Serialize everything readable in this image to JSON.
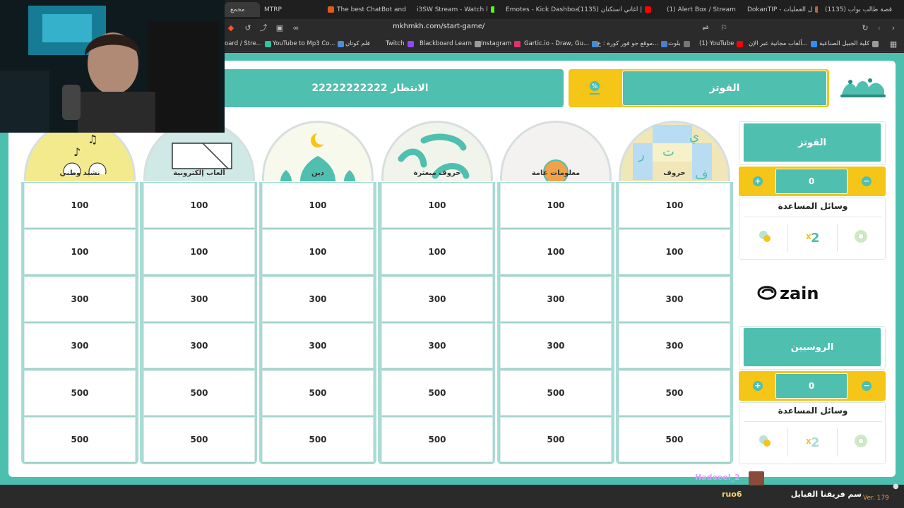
{
  "browser": {
    "tabs": [
      {
        "label": "مجمع",
        "color": "#5a5a5a"
      },
      {
        "label": "MTRP",
        "color": "#777"
      },
      {
        "label": "The best ChatBot and",
        "color": "#e25a1c"
      },
      {
        "label": "i3SW Stream - Watch l",
        "color": "#53fc18"
      },
      {
        "label": "Emotes - Kick Dashboa",
        "color": "#53fc18"
      },
      {
        "label": "(1135) اغاني استكنان |",
        "color": "#ff0000"
      },
      {
        "label": "(1) Alert Box / Stream",
        "color": "#31c3a2"
      },
      {
        "label": "DokanTIP - ل العمليات",
        "color": "#a9694a"
      },
      {
        "label": "(1135) قصة طالب بواب",
        "color": "#ff0000"
      }
    ],
    "url": "mkhmkh.com/start-game/",
    "bookmarks": [
      {
        "label": "oard / Stre...",
        "color": "#31c3a2"
      },
      {
        "label": "YouTube to Mp3 Co...",
        "color": "#4a90d9"
      },
      {
        "label": "فلم كوتان",
        "color": "#9b9b9b"
      },
      {
        "label": "Twitch",
        "color": "#9146ff"
      },
      {
        "label": "Blackboard Learn",
        "color": "#9b9b9b"
      },
      {
        "label": "Instagram",
        "color": "#e1306c"
      },
      {
        "label": "Gartic.io - Draw, Gu...",
        "color": "#3f8ed8"
      },
      {
        "label": "موقع جو فور كورة : ع...",
        "color": "#4a7fd1"
      },
      {
        "label": "بلوت",
        "color": "#777"
      },
      {
        "label": "(1) YouTube",
        "color": "#ff0000"
      },
      {
        "label": "ألعاب مجانية عبر الإن...",
        "color": "#2c8ef8"
      },
      {
        "label": "كلية الجبيل الصناعية",
        "color": "#9b9b9b"
      }
    ]
  },
  "header": {
    "waiting_label": "الانتظار 22222222222",
    "current_team": "القوتز"
  },
  "categories": [
    {
      "label": "نشيد وطني",
      "bg": "#f2ea8c"
    },
    {
      "label": "ألعاب إلكترونية",
      "bg": "#cfe9e6"
    },
    {
      "label": "دين",
      "bg": "#f6f9ec"
    },
    {
      "label": "حروف مبعثرة",
      "bg": "#f1f4ea"
    },
    {
      "label": "معلومات عامة",
      "bg": "#f4f2f0"
    },
    {
      "label": "حروف",
      "bg": "#f0e6b8"
    }
  ],
  "board": {
    "rows": [
      [
        "100",
        "100",
        "100",
        "100",
        "100",
        "100"
      ],
      [
        "100",
        "100",
        "100",
        "100",
        "100",
        "100"
      ],
      [
        "300",
        "300",
        "300",
        "300",
        "300",
        "300"
      ],
      [
        "300",
        "300",
        "300",
        "300",
        "300",
        "300"
      ],
      [
        "500",
        "500",
        "500",
        "500",
        "500",
        "500"
      ],
      [
        "500",
        "500",
        "500",
        "500",
        "500",
        "500"
      ]
    ]
  },
  "teams": [
    {
      "name": "القوتز",
      "score": "0",
      "aids_title": "وسائل المساعدة"
    },
    {
      "name": "الروسيين",
      "score": "0",
      "aids_title": "وسائل المساعدة"
    }
  ],
  "sponsor": "zain",
  "chat": {
    "username": "Hadeeel_2",
    "message": "سم فريقنا القبايل",
    "reply_user": "ruo6"
  },
  "version": "Ver. 179",
  "colors": {
    "teal": "#4fbfb0",
    "yellow": "#f5c518",
    "page_bg": "#4dbfaf"
  }
}
